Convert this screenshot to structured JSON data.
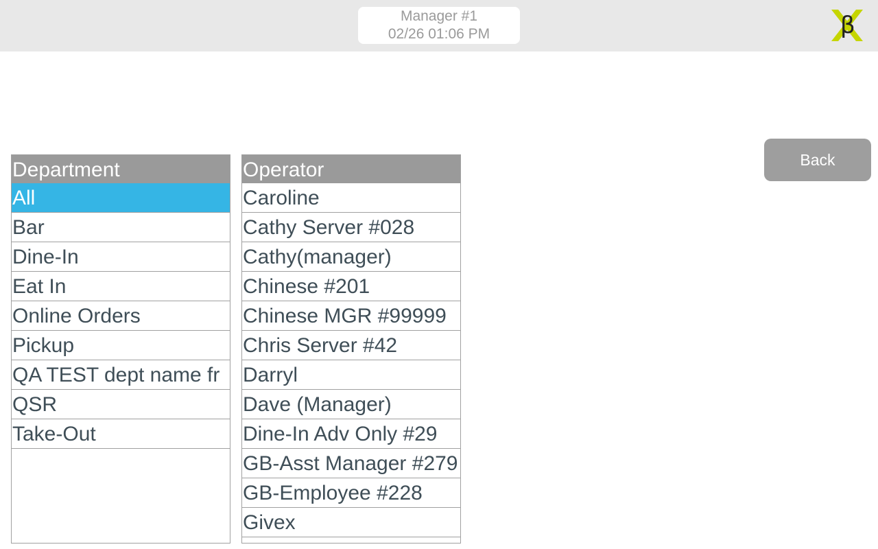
{
  "header": {
    "user": "Manager #1",
    "datetime": "02/26 01:06 PM",
    "logo_icon": "beta-x-logo-icon",
    "logo_colors": {
      "x": "#c5d500",
      "beta": "#222222"
    }
  },
  "back_label": "Back",
  "department": {
    "header": "Department",
    "selected_color": "#35b5e5",
    "items": [
      "All",
      "Bar",
      "Dine-In",
      "Eat In",
      "Online Orders",
      "Pickup",
      "QA TEST dept name fr",
      "QSR",
      "Take-Out"
    ]
  },
  "operator": {
    "header": "Operator",
    "items": [
      "Caroline",
      "Cathy Server #028",
      "Cathy(manager)",
      "Chinese #201",
      "Chinese MGR #99999",
      "Chris Server #42",
      "Darryl",
      "Dave (Manager)",
      "Dine-In Adv Only #29",
      "GB-Asst Manager #279",
      "GB-Employee #228",
      "Givex"
    ]
  }
}
